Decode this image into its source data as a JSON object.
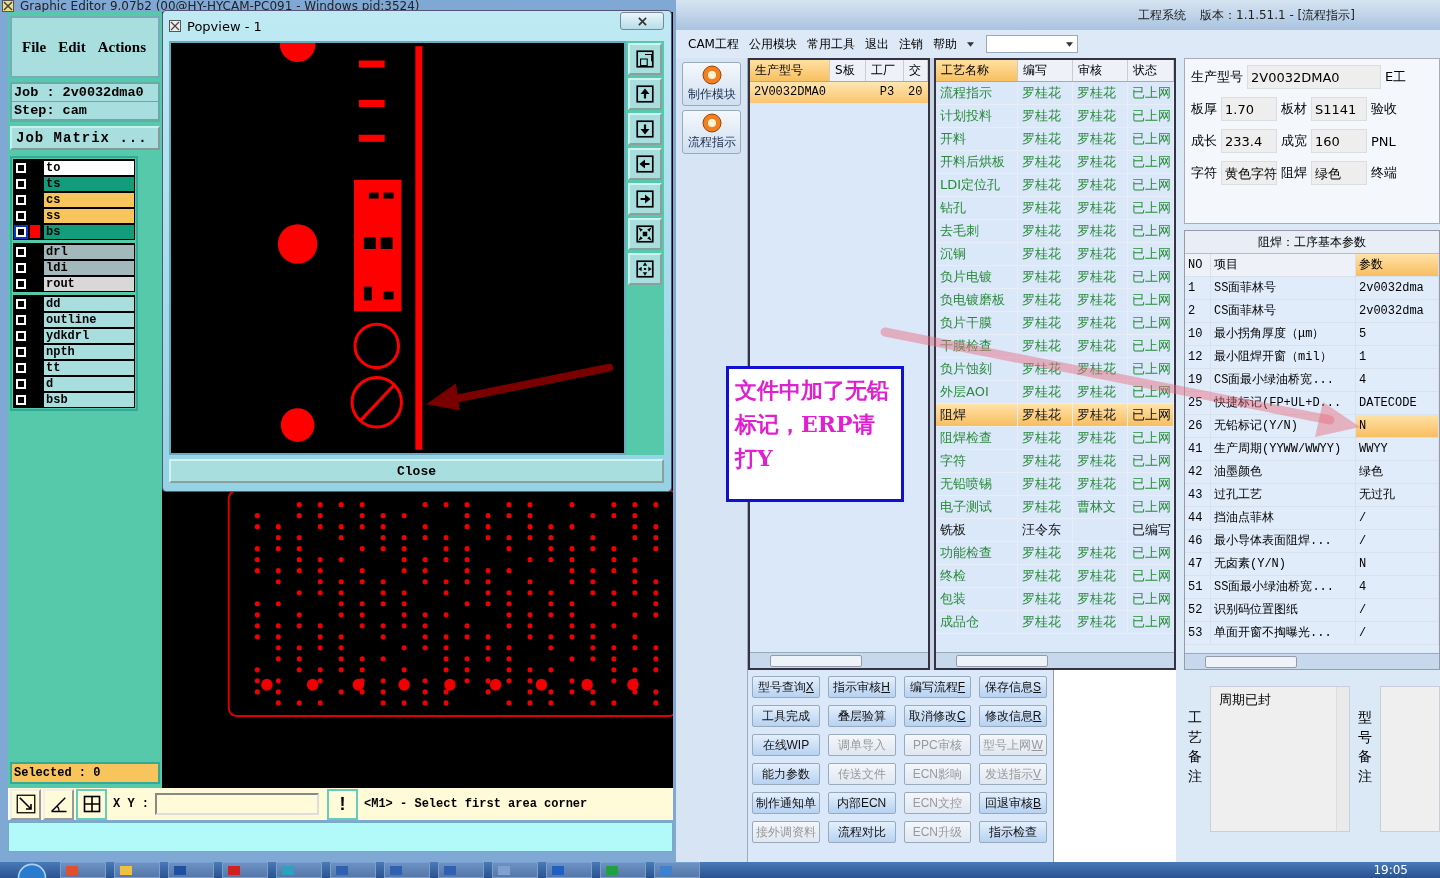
{
  "left_window": {
    "title": "Graphic Editor 9.07b2 (00@HY-HYCAM-PC091 - Windows  pid:3524)",
    "menu": [
      "File",
      "Edit",
      "Actions"
    ],
    "job": "Job : 2v0032dma0",
    "step": "Step: cam",
    "job_matrix": "Job Matrix ...",
    "layer_groups": [
      [
        {
          "name": "to",
          "color": "#ffffff",
          "checked": false,
          "active": false
        },
        {
          "name": "ts",
          "color": "#129c7c",
          "checked": false,
          "active": false
        },
        {
          "name": "cs",
          "color": "#f8c45c",
          "checked": false,
          "active": false
        },
        {
          "name": "ss",
          "color": "#f8c45c",
          "checked": false,
          "active": false
        },
        {
          "name": "bs",
          "color": "#129c7c",
          "checked": false,
          "active": true
        }
      ],
      [
        {
          "name": "drl",
          "color": "#a2b8bc",
          "checked": false,
          "active": false
        },
        {
          "name": "ldi",
          "color": "#a2b8bc",
          "checked": false,
          "active": false
        },
        {
          "name": "rout",
          "color": "#d8d8d8",
          "checked": false,
          "active": false
        }
      ],
      [
        {
          "name": "dd",
          "color": "#a8dede",
          "checked": false,
          "active": false
        },
        {
          "name": "outline",
          "color": "#a8dede",
          "checked": false,
          "active": false
        },
        {
          "name": "ydkdrl",
          "color": "#a8dede",
          "checked": false,
          "active": false
        },
        {
          "name": "npth",
          "color": "#a8dede",
          "checked": false,
          "active": false
        },
        {
          "name": "tt",
          "color": "#a8dede",
          "checked": false,
          "active": false
        },
        {
          "name": "d",
          "color": "#a8dede",
          "checked": false,
          "active": false
        },
        {
          "name": "bsb",
          "color": "#a8dede",
          "checked": false,
          "active": false
        }
      ]
    ],
    "selected_count": "Selected : 0",
    "xy_label": "X Y :",
    "alert_button": "!",
    "message": "<M1> - Select first area corner"
  },
  "popview": {
    "title": "Popview - 1",
    "close": "Close"
  },
  "erp": {
    "app_name": "工程系统",
    "version": "版本：1.1.51.1 - [流程指示]",
    "menu": [
      "CAM工程",
      "公用模块",
      "常用工具",
      "退出",
      "注销",
      "帮助"
    ],
    "side_buttons": [
      "制作模块",
      "流程指示"
    ],
    "job_table": {
      "columns": [
        "生产型号",
        "S板",
        "工厂",
        "交"
      ],
      "rows": [
        {
          "model": "2V0032DMA0",
          "factory": "P3",
          "column_4": "20",
          "selected": true
        }
      ]
    },
    "process_table": {
      "columns": [
        "工艺名称",
        "编写",
        "审核",
        "状态"
      ],
      "rows": [
        {
          "name": "流程指示",
          "writer": "罗桂花",
          "reviewer": "罗桂花",
          "status": "已上网",
          "online": true,
          "selected": false
        },
        {
          "name": "计划投料",
          "writer": "罗桂花",
          "reviewer": "罗桂花",
          "status": "已上网",
          "online": true,
          "selected": false
        },
        {
          "name": "开料",
          "writer": "罗桂花",
          "reviewer": "罗桂花",
          "status": "已上网",
          "online": true,
          "selected": false
        },
        {
          "name": "开料后烘板",
          "writer": "罗桂花",
          "reviewer": "罗桂花",
          "status": "已上网",
          "online": true,
          "selected": false
        },
        {
          "name": "LDI定位孔",
          "writer": "罗桂花",
          "reviewer": "罗桂花",
          "status": "已上网",
          "online": true,
          "selected": false
        },
        {
          "name": "钻孔",
          "writer": "罗桂花",
          "reviewer": "罗桂花",
          "status": "已上网",
          "online": true,
          "selected": false
        },
        {
          "name": "去毛刺",
          "writer": "罗桂花",
          "reviewer": "罗桂花",
          "status": "已上网",
          "online": true,
          "selected": false
        },
        {
          "name": "沉铜",
          "writer": "罗桂花",
          "reviewer": "罗桂花",
          "status": "已上网",
          "online": true,
          "selected": false
        },
        {
          "name": "负片电镀",
          "writer": "罗桂花",
          "reviewer": "罗桂花",
          "status": "已上网",
          "online": true,
          "selected": false
        },
        {
          "name": "负电镀磨板",
          "writer": "罗桂花",
          "reviewer": "罗桂花",
          "status": "已上网",
          "online": true,
          "selected": false
        },
        {
          "name": "负片干膜",
          "writer": "罗桂花",
          "reviewer": "罗桂花",
          "status": "已上网",
          "online": true,
          "selected": false
        },
        {
          "name": "干膜检查",
          "writer": "罗桂花",
          "reviewer": "罗桂花",
          "status": "已上网",
          "online": true,
          "selected": false
        },
        {
          "name": "负片蚀刻",
          "writer": "罗桂花",
          "reviewer": "罗桂花",
          "status": "已上网",
          "online": true,
          "selected": false
        },
        {
          "name": "外层AOI",
          "writer": "罗桂花",
          "reviewer": "罗桂花",
          "status": "已上网",
          "online": true,
          "selected": false
        },
        {
          "name": "阻焊",
          "writer": "罗桂花",
          "reviewer": "罗桂花",
          "status": "已上网",
          "online": true,
          "selected": true
        },
        {
          "name": "阻焊检查",
          "writer": "罗桂花",
          "reviewer": "罗桂花",
          "status": "已上网",
          "online": true,
          "selected": false
        },
        {
          "name": "字符",
          "writer": "罗桂花",
          "reviewer": "罗桂花",
          "status": "已上网",
          "online": true,
          "selected": false
        },
        {
          "name": "无铅喷锡",
          "writer": "罗桂花",
          "reviewer": "罗桂花",
          "status": "已上网",
          "online": true,
          "selected": false
        },
        {
          "name": "电子测试",
          "writer": "罗桂花",
          "reviewer": "曹林文",
          "status": "已上网",
          "online": true,
          "selected": false
        },
        {
          "name": "铣板",
          "writer": "汪令东",
          "status": "已编写",
          "online": false,
          "selected": false
        },
        {
          "name": "功能检查",
          "writer": "罗桂花",
          "reviewer": "罗桂花",
          "status": "已上网",
          "online": true,
          "selected": false
        },
        {
          "name": "终检",
          "writer": "罗桂花",
          "reviewer": "罗桂花",
          "status": "已上网",
          "online": true,
          "selected": false
        },
        {
          "name": "包装",
          "writer": "罗桂花",
          "reviewer": "罗桂花",
          "status": "已上网",
          "online": true,
          "selected": false
        },
        {
          "name": "成品仓",
          "writer": "罗桂花",
          "reviewer": "罗桂花",
          "status": "已上网",
          "online": true,
          "selected": false
        }
      ]
    },
    "note": "文件中加了无铅标记，ERP请打Y",
    "info_rows": [
      {
        "fields": [
          {
            "label": "生产型号",
            "value": "2V0032DMA0"
          }
        ],
        "trailing": "E工"
      },
      {
        "fields": [
          {
            "label": "板厚",
            "value": "1.70"
          },
          {
            "label": "板材",
            "value": "S1141"
          }
        ],
        "trailing": "验收"
      },
      {
        "fields": [
          {
            "label": "成长",
            "value": "233.4"
          },
          {
            "label": "成宽",
            "value": "160"
          }
        ],
        "trailing": "PNL"
      },
      {
        "fields": [
          {
            "label": "字符",
            "value": "黄色字符"
          },
          {
            "label": "阻焊",
            "value": "绿色"
          }
        ],
        "trailing": "终端"
      }
    ],
    "params": {
      "title": "阻焊：工序基本参数",
      "columns": [
        "NO",
        "项目",
        "参数"
      ],
      "rows": [
        {
          "no": "1",
          "item": "SS面菲林号",
          "value": "2v0032dma",
          "selected": false
        },
        {
          "no": "2",
          "item": "CS面菲林号",
          "value": "2v0032dma",
          "selected": false
        },
        {
          "no": "10",
          "item": "最小拐角厚度（μm）",
          "value": "5",
          "selected": false
        },
        {
          "no": "12",
          "item": "最小阻焊开窗（mil）",
          "value": "1",
          "selected": false
        },
        {
          "no": "19",
          "item": "CS面最小绿油桥宽...",
          "value": "4",
          "selected": false
        },
        {
          "no": "25",
          "item": "快捷标记(FP+UL+D...",
          "value": "DATECODE",
          "selected": false
        },
        {
          "no": "26",
          "item": "无铅标记(Y/N)",
          "value": "N",
          "selected": true
        },
        {
          "no": "41",
          "item": "生产周期(YYWW/WWYY)",
          "value": "WWYY",
          "selected": false
        },
        {
          "no": "42",
          "item": "油墨颜色",
          "value": "绿色",
          "selected": false
        },
        {
          "no": "43",
          "item": "过孔工艺",
          "value": "无过孔",
          "selected": false
        },
        {
          "no": "44",
          "item": "挡油点菲林",
          "value": "/",
          "selected": false
        },
        {
          "no": "46",
          "item": "最小导体表面阻焊...",
          "value": "/",
          "selected": false
        },
        {
          "no": "47",
          "item": "无卤素(Y/N)",
          "value": "N",
          "selected": false
        },
        {
          "no": "51",
          "item": "SS面最小绿油桥宽...",
          "value": "4",
          "selected": false
        },
        {
          "no": "52",
          "item": "识别码位置图纸",
          "value": "/",
          "selected": false
        },
        {
          "no": "53",
          "item": "单面开窗不掏曝光...",
          "value": "/",
          "selected": false
        }
      ]
    },
    "buttons": [
      {
        "label": "型号查询",
        "hotkey": "X",
        "disabled": false
      },
      {
        "label": "指示审核",
        "hotkey": "H",
        "disabled": false
      },
      {
        "label": "编写流程",
        "hotkey": "F",
        "disabled": false
      },
      {
        "label": "保存信息",
        "hotkey": "S",
        "disabled": false
      },
      {
        "label": "工具完成",
        "disabled": false
      },
      {
        "label": "叠层验算",
        "disabled": false
      },
      {
        "label": "取消修改",
        "hotkey": "C",
        "disabled": false
      },
      {
        "label": "修改信息",
        "hotkey": "R",
        "disabled": false
      },
      {
        "label": "在线WIP",
        "disabled": false
      },
      {
        "label": "调单导入",
        "disabled": true
      },
      {
        "label": "PPC审核",
        "disabled": true
      },
      {
        "label": "型号上网",
        "hotkey": "W",
        "disabled": true
      },
      {
        "label": "能力参数",
        "disabled": false
      },
      {
        "label": "传送文件",
        "disabled": true
      },
      {
        "label": "ECN影响",
        "disabled": true
      },
      {
        "label": "发送指示",
        "hotkey": "V",
        "disabled": true
      },
      {
        "label": "制作通知单",
        "disabled": false
      },
      {
        "label": "内部ECN",
        "disabled": false
      },
      {
        "label": "ECN文控",
        "disabled": true
      },
      {
        "label": "回退审核",
        "hotkey": "B",
        "disabled": false
      },
      {
        "label": "接外调资料",
        "disabled": true
      },
      {
        "label": "流程对比",
        "disabled": false
      },
      {
        "label": "ECN升级",
        "disabled": true
      },
      {
        "label": "指示检查",
        "disabled": false
      }
    ],
    "remarks": [
      {
        "label": "工艺备注",
        "text": "周期已封"
      },
      {
        "label": "型号备注"
      }
    ]
  },
  "taskbar": {
    "clock": "19:05"
  }
}
